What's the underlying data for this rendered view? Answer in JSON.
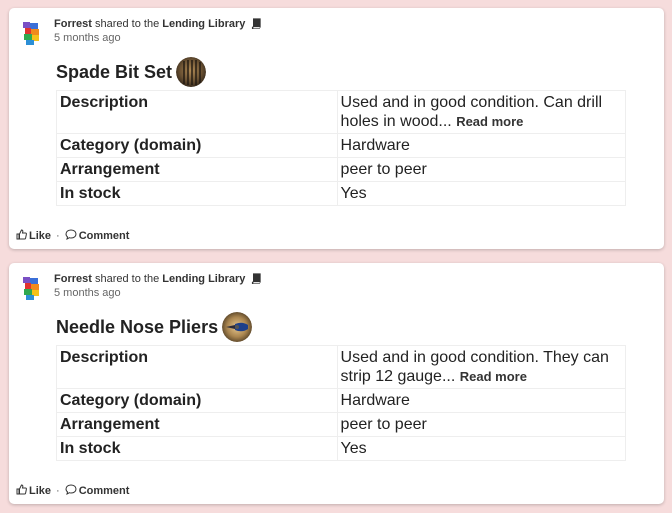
{
  "posts": [
    {
      "author": "Forrest",
      "shared_text": "shared to the",
      "group": "Lending Library",
      "time_ago": "5 months ago",
      "item_title": "Spade Bit Set",
      "rows": [
        {
          "key": "Description",
          "value": "Used and in good condition. Can drill holes in wood...",
          "more": "Read more"
        },
        {
          "key": "Category (domain)",
          "value": "Hardware"
        },
        {
          "key": "Arrangement",
          "value": "peer to peer"
        },
        {
          "key": "In stock",
          "value": "Yes"
        }
      ],
      "like_label": "Like",
      "separator": "·",
      "comment_label": "Comment"
    },
    {
      "author": "Forrest",
      "shared_text": "shared to the",
      "group": "Lending Library",
      "time_ago": "5 months ago",
      "item_title": "Needle Nose Pliers",
      "rows": [
        {
          "key": "Description",
          "value": "Used and in good condition. They can strip 12 gauge...",
          "more": "Read more"
        },
        {
          "key": "Category (domain)",
          "value": "Hardware"
        },
        {
          "key": "Arrangement",
          "value": "peer to peer"
        },
        {
          "key": "In stock",
          "value": "Yes"
        }
      ],
      "like_label": "Like",
      "separator": "·",
      "comment_label": "Comment"
    }
  ],
  "icons": {
    "avatar": "colorful-logo-avatar",
    "group": "book-icon",
    "like": "thumbs-up-icon",
    "comment": "speech-bubble-icon"
  }
}
